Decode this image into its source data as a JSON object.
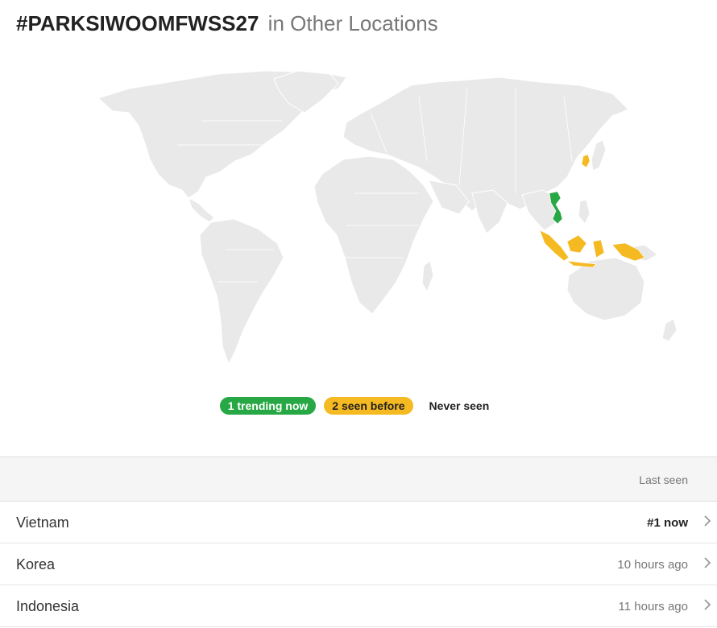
{
  "header": {
    "hashtag": "#PARKSIWOOMFWSS27",
    "suffix": "in Other Locations"
  },
  "map": {
    "trending_countries": [
      "Vietnam"
    ],
    "seen_before_countries": [
      "Korea",
      "Indonesia"
    ]
  },
  "legend": {
    "trending_label": "1 trending now",
    "seen_label": "2 seen before",
    "never_label": "Never seen"
  },
  "table": {
    "column_last_seen": "Last seen",
    "rows": [
      {
        "country": "Vietnam",
        "last_seen": "#1 now",
        "icon": "chevron-right-icon"
      },
      {
        "country": "Korea",
        "last_seen": "10 hours ago",
        "icon": "chevron-right-icon"
      },
      {
        "country": "Indonesia",
        "last_seen": "11 hours ago",
        "icon": "chevron-right-icon"
      }
    ]
  },
  "colors": {
    "trending": "#27a844",
    "seen": "#f5b921",
    "land": "#e9e9e9",
    "never": "#ffffff"
  }
}
